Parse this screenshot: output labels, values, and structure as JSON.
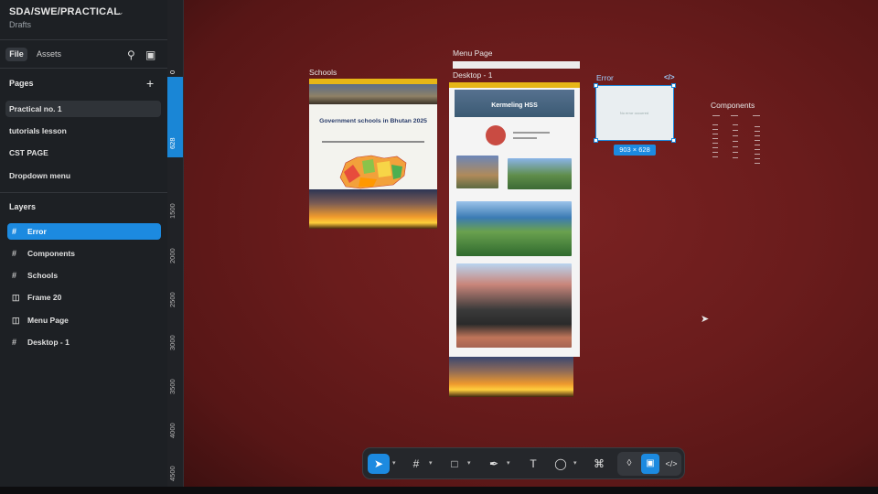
{
  "project": {
    "title": "SDA/SWE/PRACTICAL",
    "subtitle": "Drafts"
  },
  "tabs": {
    "file": "File",
    "assets": "Assets"
  },
  "pages": {
    "heading": "Pages",
    "items": [
      "Practical no. 1",
      "tutorials lesson",
      "CST PAGE",
      "Dropdown menu"
    ],
    "selected": "Practical no. 1"
  },
  "layers": {
    "heading": "Layers",
    "items": [
      {
        "label": "Error",
        "icon": "frame-icon",
        "selected": true
      },
      {
        "label": "Components",
        "icon": "frame-icon",
        "selected": false
      },
      {
        "label": "Schools",
        "icon": "frame-icon",
        "selected": false
      },
      {
        "label": "Frame 20",
        "icon": "flex-layout-icon",
        "selected": false
      },
      {
        "label": "Menu Page",
        "icon": "flex-layout-icon",
        "selected": false
      },
      {
        "label": "Desktop - 1",
        "icon": "frame-icon",
        "selected": false
      }
    ]
  },
  "ruler": {
    "ticks": [
      "0",
      "628",
      "1500",
      "2000",
      "2500",
      "3000",
      "3500",
      "4000",
      "4500"
    ]
  },
  "canvas": {
    "frames": {
      "schools": "Schools",
      "menu_page": "Menu Page",
      "desktop": "Desktop - 1",
      "error": "Error",
      "components": "Components"
    },
    "schools_title": "Government schools in Bhutan 2025",
    "desktop_hero": "Kermeling HSS",
    "error_text": "No error occurred",
    "selection_size": "903 × 628"
  },
  "toolbar": {
    "tools": [
      "move-tool",
      "frame-tool",
      "shape-tool",
      "pen-tool",
      "text-tool",
      "comment-tool",
      "actions-tool"
    ],
    "active": "move-tool",
    "modes": [
      "design-mode",
      "draw-mode",
      "dev-mode"
    ],
    "active_mode": "draw-mode"
  },
  "colors": {
    "accent": "#1c8ae0",
    "canvas": "#6a1c1c",
    "sidebar": "#1d2024",
    "frame_header": "#e6b617"
  }
}
